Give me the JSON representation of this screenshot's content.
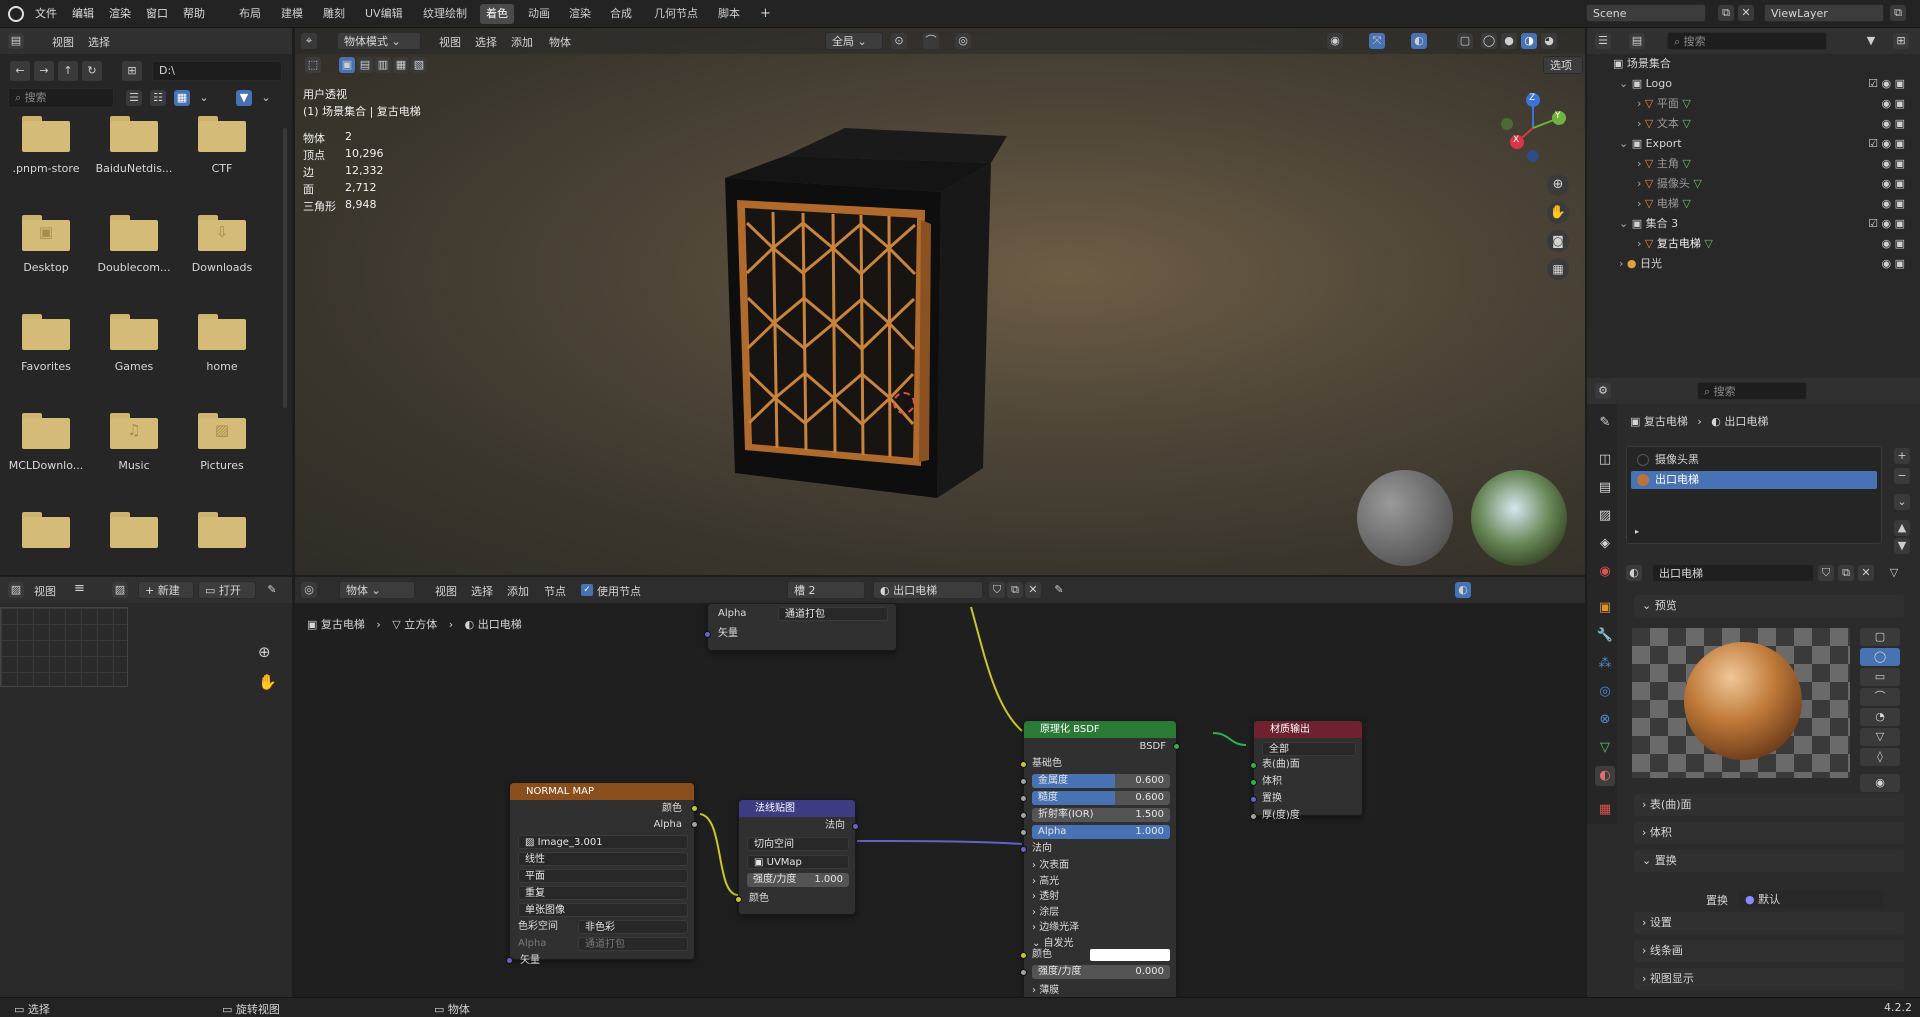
{
  "topbar": {
    "menus": [
      "文件",
      "编辑",
      "渲染",
      "窗口",
      "帮助"
    ],
    "workspaces": [
      "布局",
      "建模",
      "雕刻",
      "UV编辑",
      "纹理绘制",
      "着色",
      "动画",
      "渲染",
      "合成",
      "几何节点",
      "脚本"
    ],
    "active_workspace": "着色",
    "add_tab": "+",
    "scene": "Scene",
    "view_layer": "ViewLayer"
  },
  "filebrowser": {
    "menus": [
      "视图",
      "选择"
    ],
    "path": "D:\\",
    "search_placeholder": "搜索",
    "items": [
      {
        "label": ".pnpm-store",
        "sym": ""
      },
      {
        "label": "BaiduNetdis...",
        "sym": ""
      },
      {
        "label": "CTF",
        "sym": ""
      },
      {
        "label": "Desktop",
        "sym": "▣"
      },
      {
        "label": "Doublecom...",
        "sym": ""
      },
      {
        "label": "Downloads",
        "sym": "⇩"
      },
      {
        "label": "Favorites",
        "sym": ""
      },
      {
        "label": "Games",
        "sym": ""
      },
      {
        "label": "home",
        "sym": ""
      },
      {
        "label": "MCLDownlo...",
        "sym": ""
      },
      {
        "label": "Music",
        "sym": "♫"
      },
      {
        "label": "Pictures",
        "sym": "▨"
      }
    ]
  },
  "image_editor": {
    "view_menu": "视图",
    "new_label": "新建",
    "open_label": "打开"
  },
  "viewport": {
    "mode": "物体模式",
    "menus": [
      "视图",
      "选择",
      "添加",
      "物体"
    ],
    "transform_orientation": "全局",
    "options_label": "选项",
    "title": "用户透视",
    "subtitle": "(1) 场景集合 | 复古电梯",
    "stats": [
      {
        "k": "物体",
        "v": "2"
      },
      {
        "k": "顶点",
        "v": "10,296"
      },
      {
        "k": "边",
        "v": "12,332"
      },
      {
        "k": "面",
        "v": "2,712"
      },
      {
        "k": "三角形",
        "v": "8,948"
      }
    ],
    "gizmo": {
      "z": "Z",
      "y": "Y",
      "x": "X"
    }
  },
  "node_editor": {
    "object_label": "物体",
    "menus": [
      "视图",
      "选择",
      "添加",
      "节点"
    ],
    "use_nodes": "使用节点",
    "slot": "槽 2",
    "material": "出口电梯",
    "breadcrumb": [
      "复古电梯",
      "立方体",
      "出口电梯"
    ],
    "partial_node": {
      "alpha_label": "Alpha",
      "alpha_value": "通道打包",
      "vector": "矢量"
    },
    "normal_map_node": {
      "title": "NORMAL MAP",
      "outputs": [
        "颜色",
        "Alpha"
      ],
      "image": "Image_3.001",
      "interp": "线性",
      "projection": "平面",
      "extension": "重复",
      "source": "单张图像",
      "colorspace_label": "色彩空间",
      "colorspace": "非色彩",
      "alpha_label": "Alpha",
      "alpha_value": "通道打包",
      "vector": "矢量"
    },
    "normal_node": {
      "title": "法线贴图",
      "output": "法向",
      "space": "切向空间",
      "uvmap": "UVMap",
      "strength_label": "强度/力度",
      "strength": "1.000",
      "color": "颜色"
    },
    "bsdf_node": {
      "title": "原理化 BSDF",
      "output": "BSDF",
      "base_color": "基础色",
      "metallic_label": "金属度",
      "metallic": "0.600",
      "metallic_fill": 0.6,
      "roughness_label": "糙度",
      "roughness": "0.600",
      "roughness_fill": 0.6,
      "ior_label": "折射率(IOR)",
      "ior": "1.500",
      "alpha_label": "Alpha",
      "alpha": "1.000",
      "alpha_fill": 1.0,
      "normal": "法向",
      "subsections": [
        "次表面",
        "高光",
        "透射",
        "涂层",
        "边缘光泽",
        "自发光"
      ],
      "emission_color": "颜色",
      "emission_strength_label": "强度/力度",
      "emission_strength": "0.000",
      "thin_film": "薄膜"
    },
    "output_node": {
      "title": "材质输出",
      "target": "全部",
      "inputs": [
        "表(曲)面",
        "体积",
        "置换",
        "厚(度)度"
      ]
    }
  },
  "outliner": {
    "search_placeholder": "搜索",
    "root": "场景集合",
    "rows": [
      {
        "label": "Logo",
        "indent": 1,
        "type": "collection"
      },
      {
        "label": "平面",
        "indent": 2,
        "type": "mesh"
      },
      {
        "label": "文本",
        "indent": 2,
        "type": "mesh"
      },
      {
        "label": "Export",
        "indent": 1,
        "type": "collection"
      },
      {
        "label": "主角",
        "indent": 2,
        "type": "mesh"
      },
      {
        "label": "摄像头",
        "indent": 2,
        "type": "mesh"
      },
      {
        "label": "电梯",
        "indent": 2,
        "type": "mesh"
      },
      {
        "label": "集合 3",
        "indent": 1,
        "type": "collection"
      },
      {
        "label": "复古电梯",
        "indent": 2,
        "type": "mesh"
      },
      {
        "label": "日光",
        "indent": 1,
        "type": "light"
      }
    ]
  },
  "properties": {
    "search_placeholder": "搜索",
    "breadcrumb_obj": "复古电梯",
    "breadcrumb_mat": "出口电梯",
    "slots": [
      "摄像头黑",
      "出口电梯"
    ],
    "material_name": "出口电梯",
    "preview_label": "预览",
    "sections": [
      "表(曲)面",
      "体积",
      "置换",
      "设置",
      "线条画",
      "视图显示"
    ],
    "displacement_label": "置换",
    "displacement_value": "默认"
  },
  "statusbar": {
    "select": "选择",
    "rotate": "旋转视图",
    "object": "物体",
    "version": "4.2.2"
  },
  "colors": {
    "accent": "#4772b3",
    "frame": "#c8843c",
    "nm_header": "#8a4d1c",
    "normal_header": "#3c3c82",
    "bsdf_header": "#2a7a35",
    "output_header": "#6e2230"
  }
}
